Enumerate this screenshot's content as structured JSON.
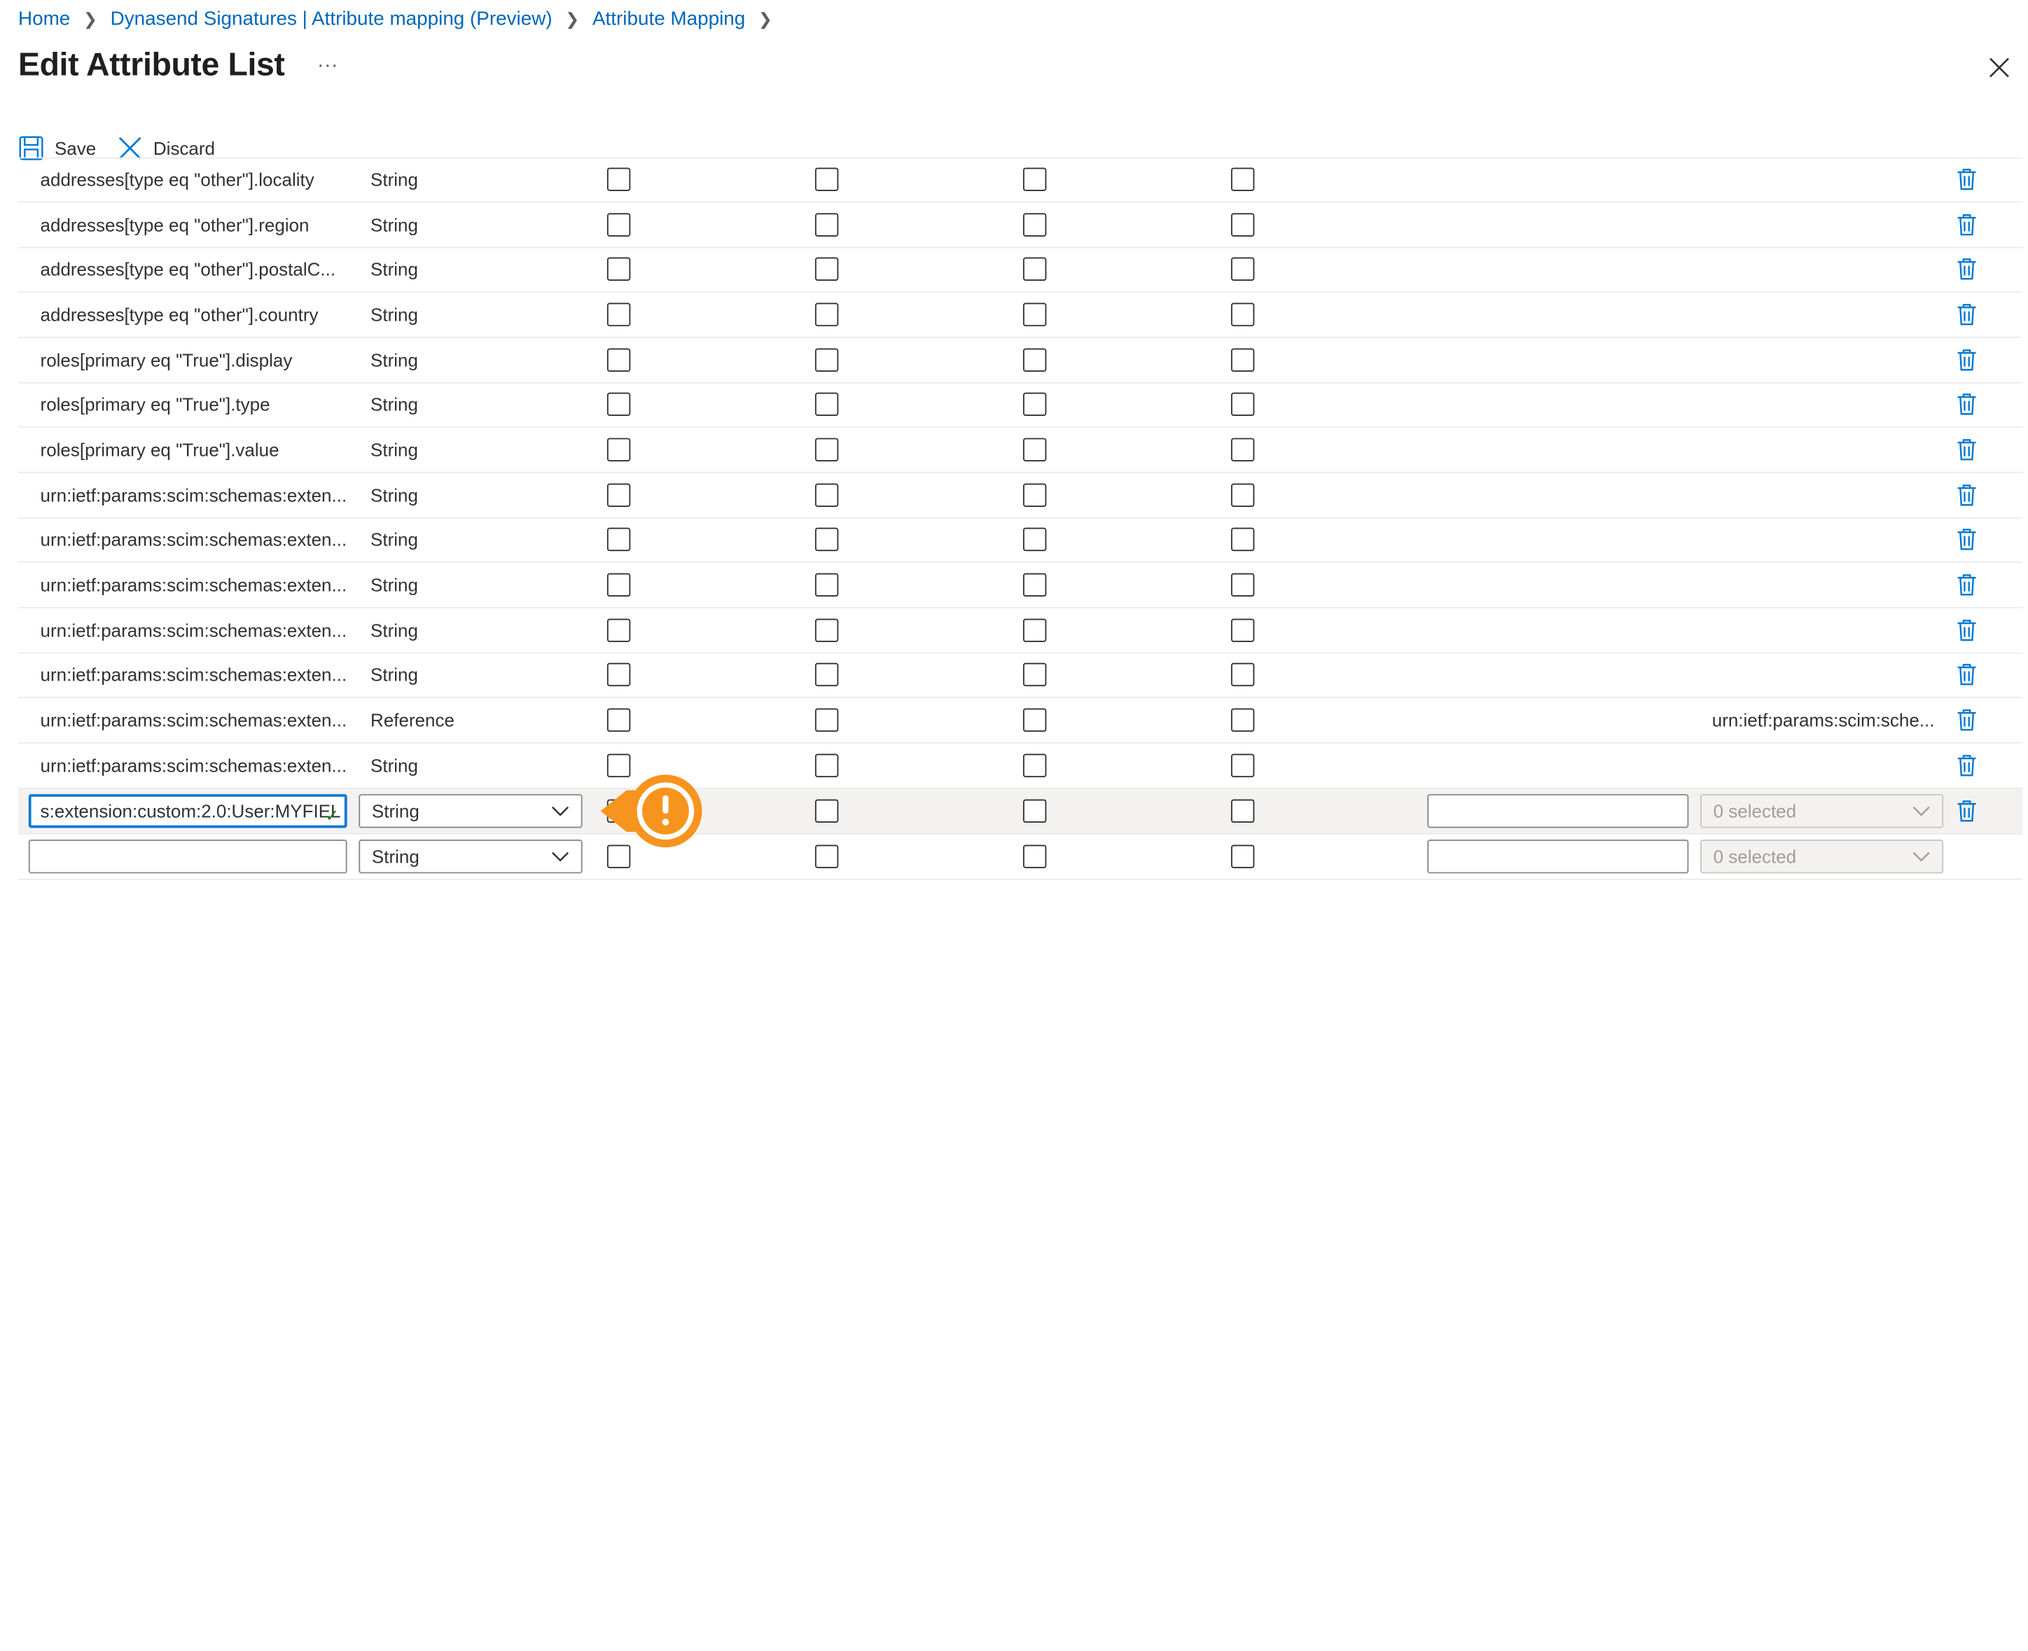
{
  "breadcrumb": [
    {
      "label": "Home"
    },
    {
      "label": "Dynasend Signatures | Attribute mapping (Preview)"
    },
    {
      "label": "Attribute Mapping"
    }
  ],
  "page_title": "Edit Attribute List",
  "more_label": "···",
  "toolbar": {
    "save_label": "Save",
    "discard_label": "Discard"
  },
  "rows": [
    {
      "name": "addresses[type eq \"other\"].locality",
      "type": "String",
      "reference": ""
    },
    {
      "name": "addresses[type eq \"other\"].region",
      "type": "String",
      "reference": ""
    },
    {
      "name": "addresses[type eq \"other\"].postalC...",
      "type": "String",
      "reference": ""
    },
    {
      "name": "addresses[type eq \"other\"].country",
      "type": "String",
      "reference": ""
    },
    {
      "name": "roles[primary eq \"True\"].display",
      "type": "String",
      "reference": ""
    },
    {
      "name": "roles[primary eq \"True\"].type",
      "type": "String",
      "reference": ""
    },
    {
      "name": "roles[primary eq \"True\"].value",
      "type": "String",
      "reference": ""
    },
    {
      "name": "urn:ietf:params:scim:schemas:exten...",
      "type": "String",
      "reference": ""
    },
    {
      "name": "urn:ietf:params:scim:schemas:exten...",
      "type": "String",
      "reference": ""
    },
    {
      "name": "urn:ietf:params:scim:schemas:exten...",
      "type": "String",
      "reference": ""
    },
    {
      "name": "urn:ietf:params:scim:schemas:exten...",
      "type": "String",
      "reference": ""
    },
    {
      "name": "urn:ietf:params:scim:schemas:exten...",
      "type": "String",
      "reference": ""
    },
    {
      "name": "urn:ietf:params:scim:schemas:exten...",
      "type": "Reference",
      "reference": "urn:ietf:params:scim:sche..."
    },
    {
      "name": "urn:ietf:params:scim:schemas:exten...",
      "type": "String",
      "reference": ""
    }
  ],
  "edit_row": {
    "name_value": "s:extension:custom:2.0:User:MYFIEL",
    "type_value": "String",
    "reference_value": "",
    "selected_label": "0 selected"
  },
  "new_row": {
    "name_value": "",
    "type_value": "String",
    "reference_value": "",
    "selected_label": "0 selected"
  },
  "colors": {
    "accent": "#0078d4",
    "link": "#0067b8",
    "callout": "#f7941d",
    "trash": "#0078d4"
  }
}
